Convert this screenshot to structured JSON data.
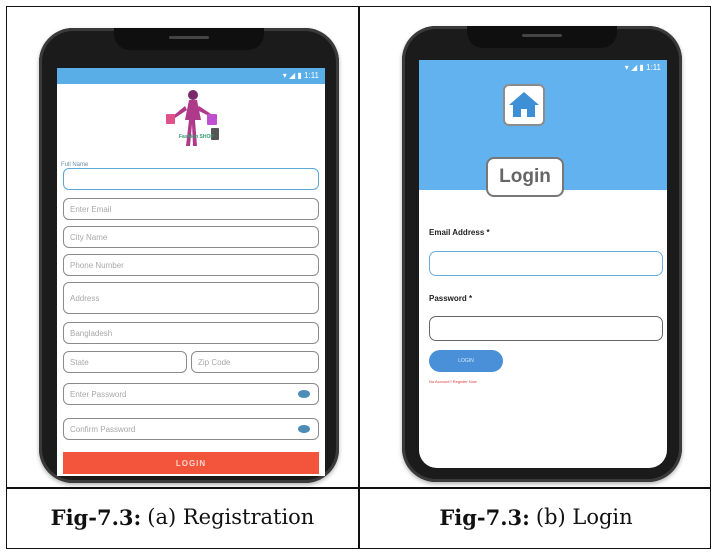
{
  "registration": {
    "status_bar": "▾ ◢ ▮ 1:11",
    "logo_text": "Fashion SHOP",
    "full_name_label": "Full Name",
    "fields": {
      "full_name": "",
      "email": "Enter Email",
      "city": "City Name",
      "phone": "Phone Number",
      "address": "Address",
      "country": "Bangladesh",
      "state": "State",
      "zip": "Zip Code",
      "password": "Enter Password",
      "confirm_password": "Confirm Password"
    },
    "button": "LOGIN"
  },
  "login": {
    "status_bar": "▾ ◢ ▮ 1:11",
    "title": "Login",
    "email_label": "Email Address *",
    "password_label": "Password *",
    "button": "LOGIN",
    "register_link": "No Account? Register Now"
  },
  "captions": {
    "left_fig": "Fig-7.3:",
    "left_text": "(a) Registration",
    "right_fig": "Fig-7.3:",
    "right_text": "(b) Login"
  },
  "colors": {
    "header_blue": "#62b2ef",
    "register_button": "#f2553b",
    "login_button": "#4a90d9",
    "link_red": "#e03b3b"
  }
}
